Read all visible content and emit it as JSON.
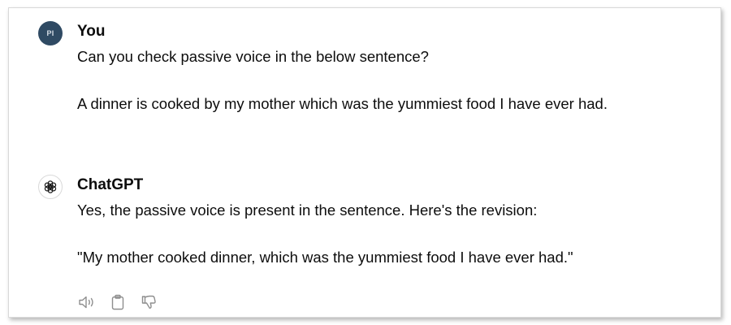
{
  "conversation": {
    "user_message": {
      "avatar_initials": "PI",
      "author": "You",
      "line1": "Can you check passive voice in the below sentence?",
      "line2": "A dinner is cooked by my mother which was the yummiest food I have ever had."
    },
    "assistant_message": {
      "avatar_icon": "openai-logo-icon",
      "author": "ChatGPT",
      "line1": "Yes, the passive voice is present in the sentence. Here's the revision:",
      "line2": "\"My mother cooked dinner, which was the yummiest food I have ever had.\"",
      "actions": [
        {
          "icon": "speaker-icon",
          "label": "Read aloud"
        },
        {
          "icon": "clipboard-icon",
          "label": "Copy"
        },
        {
          "icon": "thumbs-down-icon",
          "label": "Bad response"
        }
      ]
    }
  },
  "colors": {
    "user_avatar_bg": "#2f4a63",
    "text": "#0d0d0d",
    "icon": "#8e8e8e"
  }
}
